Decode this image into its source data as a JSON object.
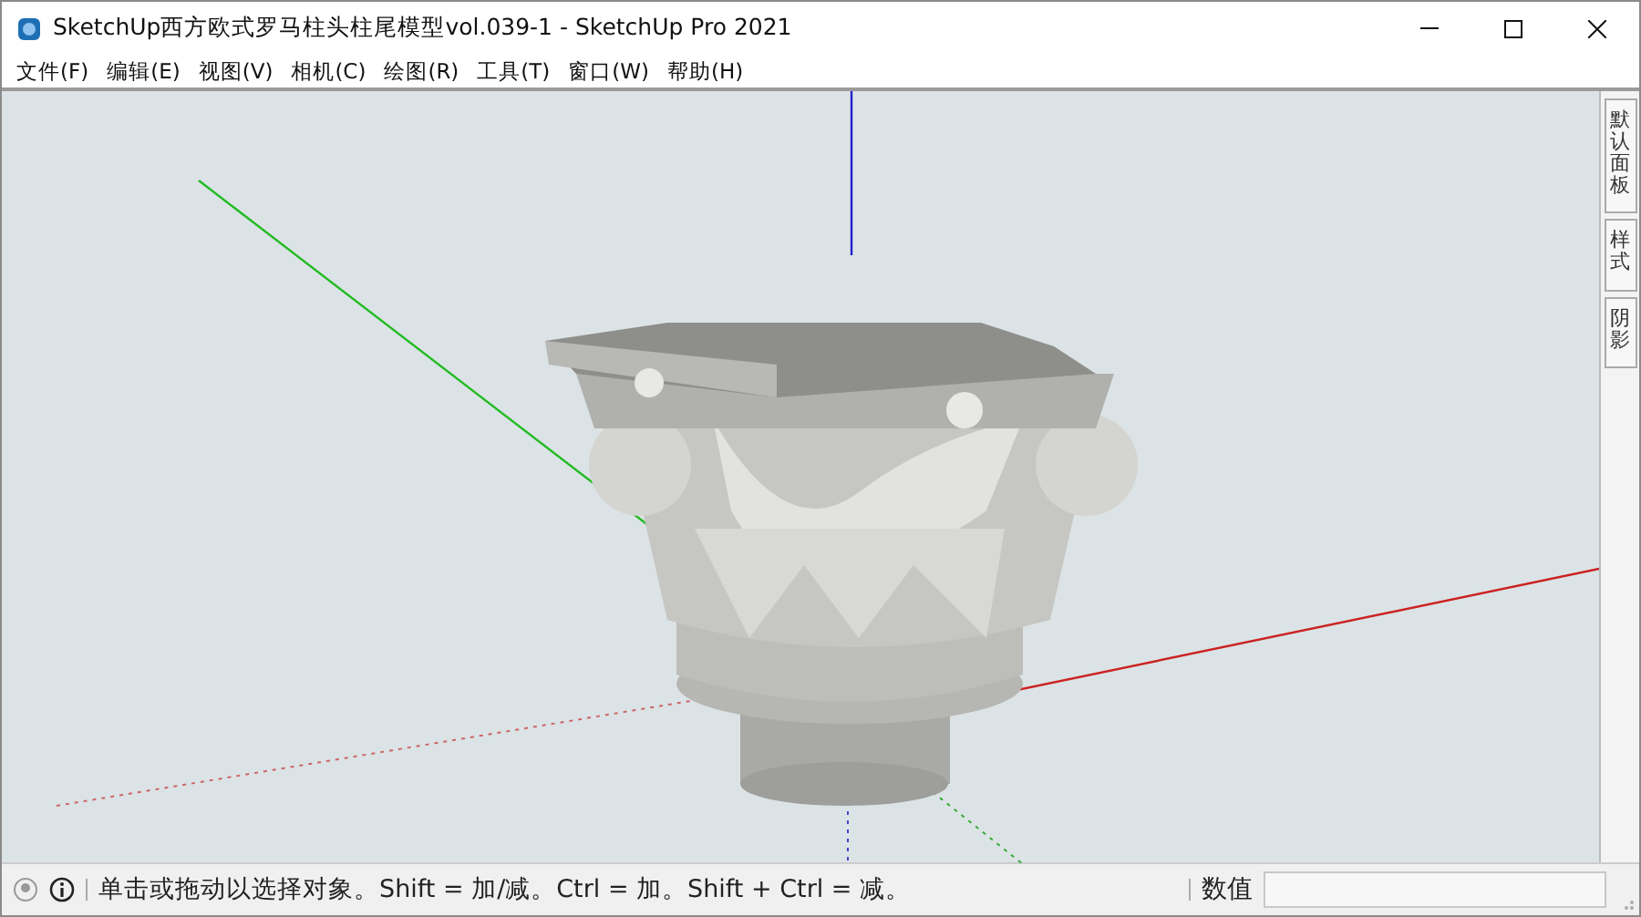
{
  "window": {
    "title": "SketchUp西方欧式罗马柱头柱尾模型vol.039-1 - SketchUp Pro 2021"
  },
  "menu": [
    "文件(F)",
    "编辑(E)",
    "视图(V)",
    "相机(C)",
    "绘图(R)",
    "工具(T)",
    "窗口(W)",
    "帮助(H)"
  ],
  "side_tabs": [
    {
      "label": "默认面板"
    },
    {
      "label": "样式"
    },
    {
      "label": "阴影"
    }
  ],
  "status_bar": {
    "message": "单击或拖动以选择对象。Shift = 加/减。Ctrl = 加。Shift + Ctrl = 减。",
    "value_label": "数值"
  }
}
